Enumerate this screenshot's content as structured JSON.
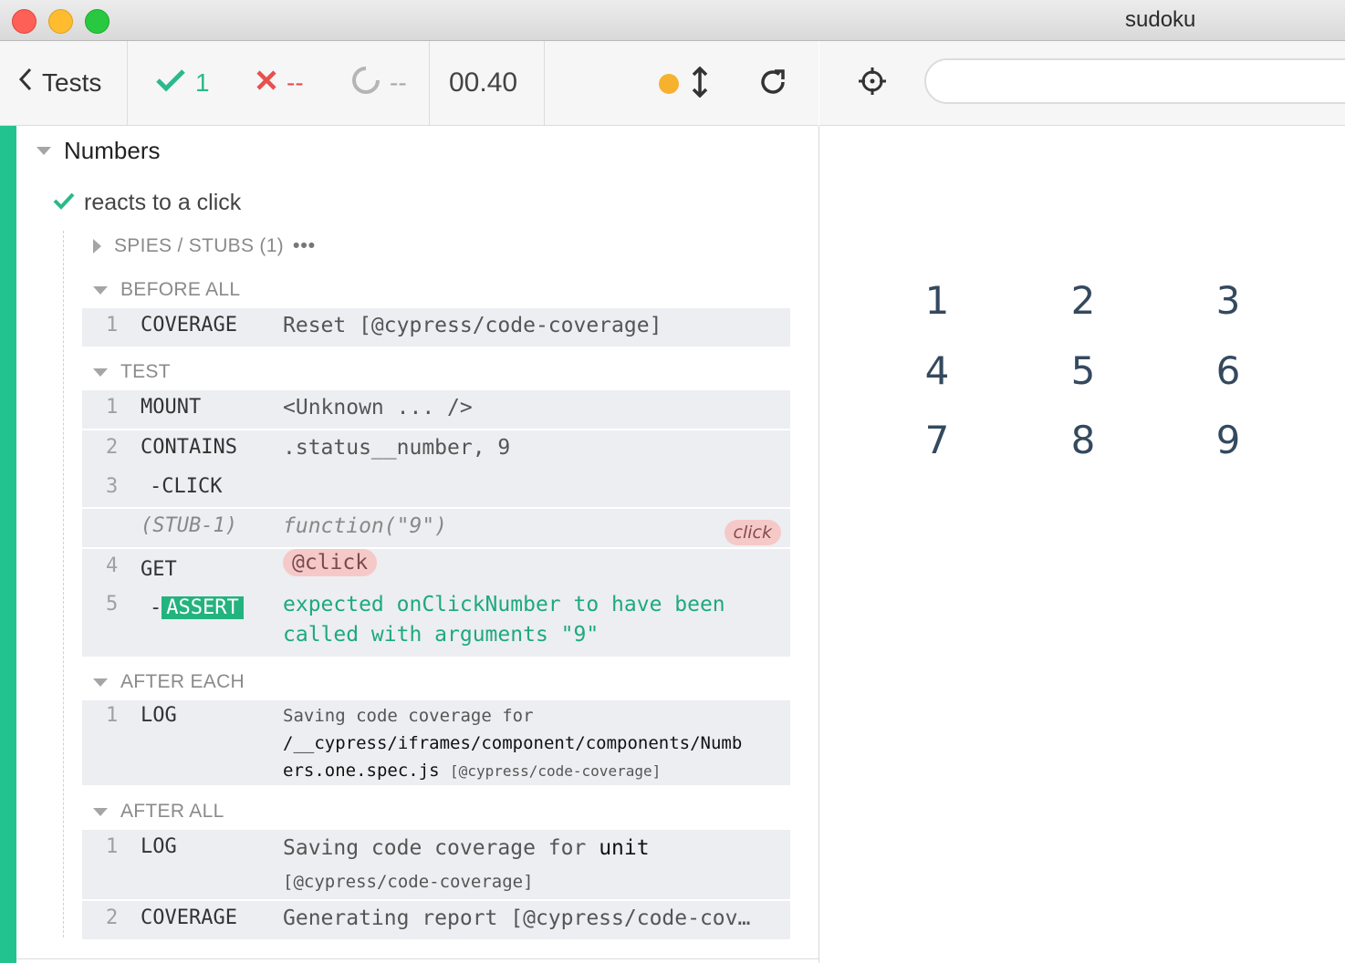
{
  "window": {
    "title": "sudoku"
  },
  "header": {
    "tests_label": "Tests",
    "passed_count": "1",
    "failed_count": "--",
    "pending_count": "--",
    "duration": "00.40"
  },
  "suite": {
    "title": "Numbers",
    "test_title": "reacts to a click",
    "spies_label": "SPIES / STUBS (1)",
    "spies_more": "•••",
    "before_all": {
      "label": "BEFORE ALL",
      "commands": [
        {
          "num": "1",
          "name": "COVERAGE",
          "message": "Reset [@cypress/code-coverage]"
        }
      ]
    },
    "test": {
      "label": "TEST",
      "commands": [
        {
          "num": "1",
          "name": "MOUNT",
          "message": "<Unknown ... />"
        },
        {
          "num": "2",
          "name": "CONTAINS",
          "message": ".status__number, 9"
        },
        {
          "num": "3",
          "name": "-CLICK",
          "message": ""
        },
        {
          "num": "",
          "name": "(STUB-1)",
          "message": "function(\"9\")",
          "pill": "click"
        },
        {
          "num": "4",
          "name": "GET",
          "message": "@click"
        },
        {
          "num": "5",
          "name_prefix": "-",
          "name": "ASSERT",
          "message_line1": "expected onClickNumber to have been",
          "message_line2": "called with arguments \"9\""
        }
      ]
    },
    "after_each": {
      "label": "AFTER EACH",
      "commands": [
        {
          "num": "1",
          "name": "LOG",
          "message_line1": "Saving code coverage for",
          "message_line2": "/__cypress/iframes/component/components/Numb",
          "message_line3_main": "ers.one.spec.js",
          "message_line3_tag": "[@cypress/code-coverage]"
        }
      ]
    },
    "after_all": {
      "label": "AFTER ALL",
      "commands": [
        {
          "num": "1",
          "name": "LOG",
          "message_line1_a": "Saving code coverage for",
          "message_line1_b": "unit",
          "message_line2": "[@cypress/code-coverage]"
        },
        {
          "num": "2",
          "name": "COVERAGE",
          "message": "Generating report [@cypress/code-cov…"
        }
      ]
    }
  },
  "app": {
    "url_value": "",
    "numbers": [
      "1",
      "2",
      "3",
      "4",
      "5",
      "6",
      "7",
      "8",
      "9"
    ]
  },
  "colors": {
    "pass": "#2ab98c",
    "fail": "#e94f4f",
    "running_dot": "#f6b12e",
    "sidebar": "#23c38f"
  },
  "icons": [
    "chevron-left-icon",
    "check-icon",
    "x-icon",
    "spinner-icon",
    "dot-icon",
    "scroll-arrows-icon",
    "reload-icon",
    "crosshair-icon"
  ]
}
